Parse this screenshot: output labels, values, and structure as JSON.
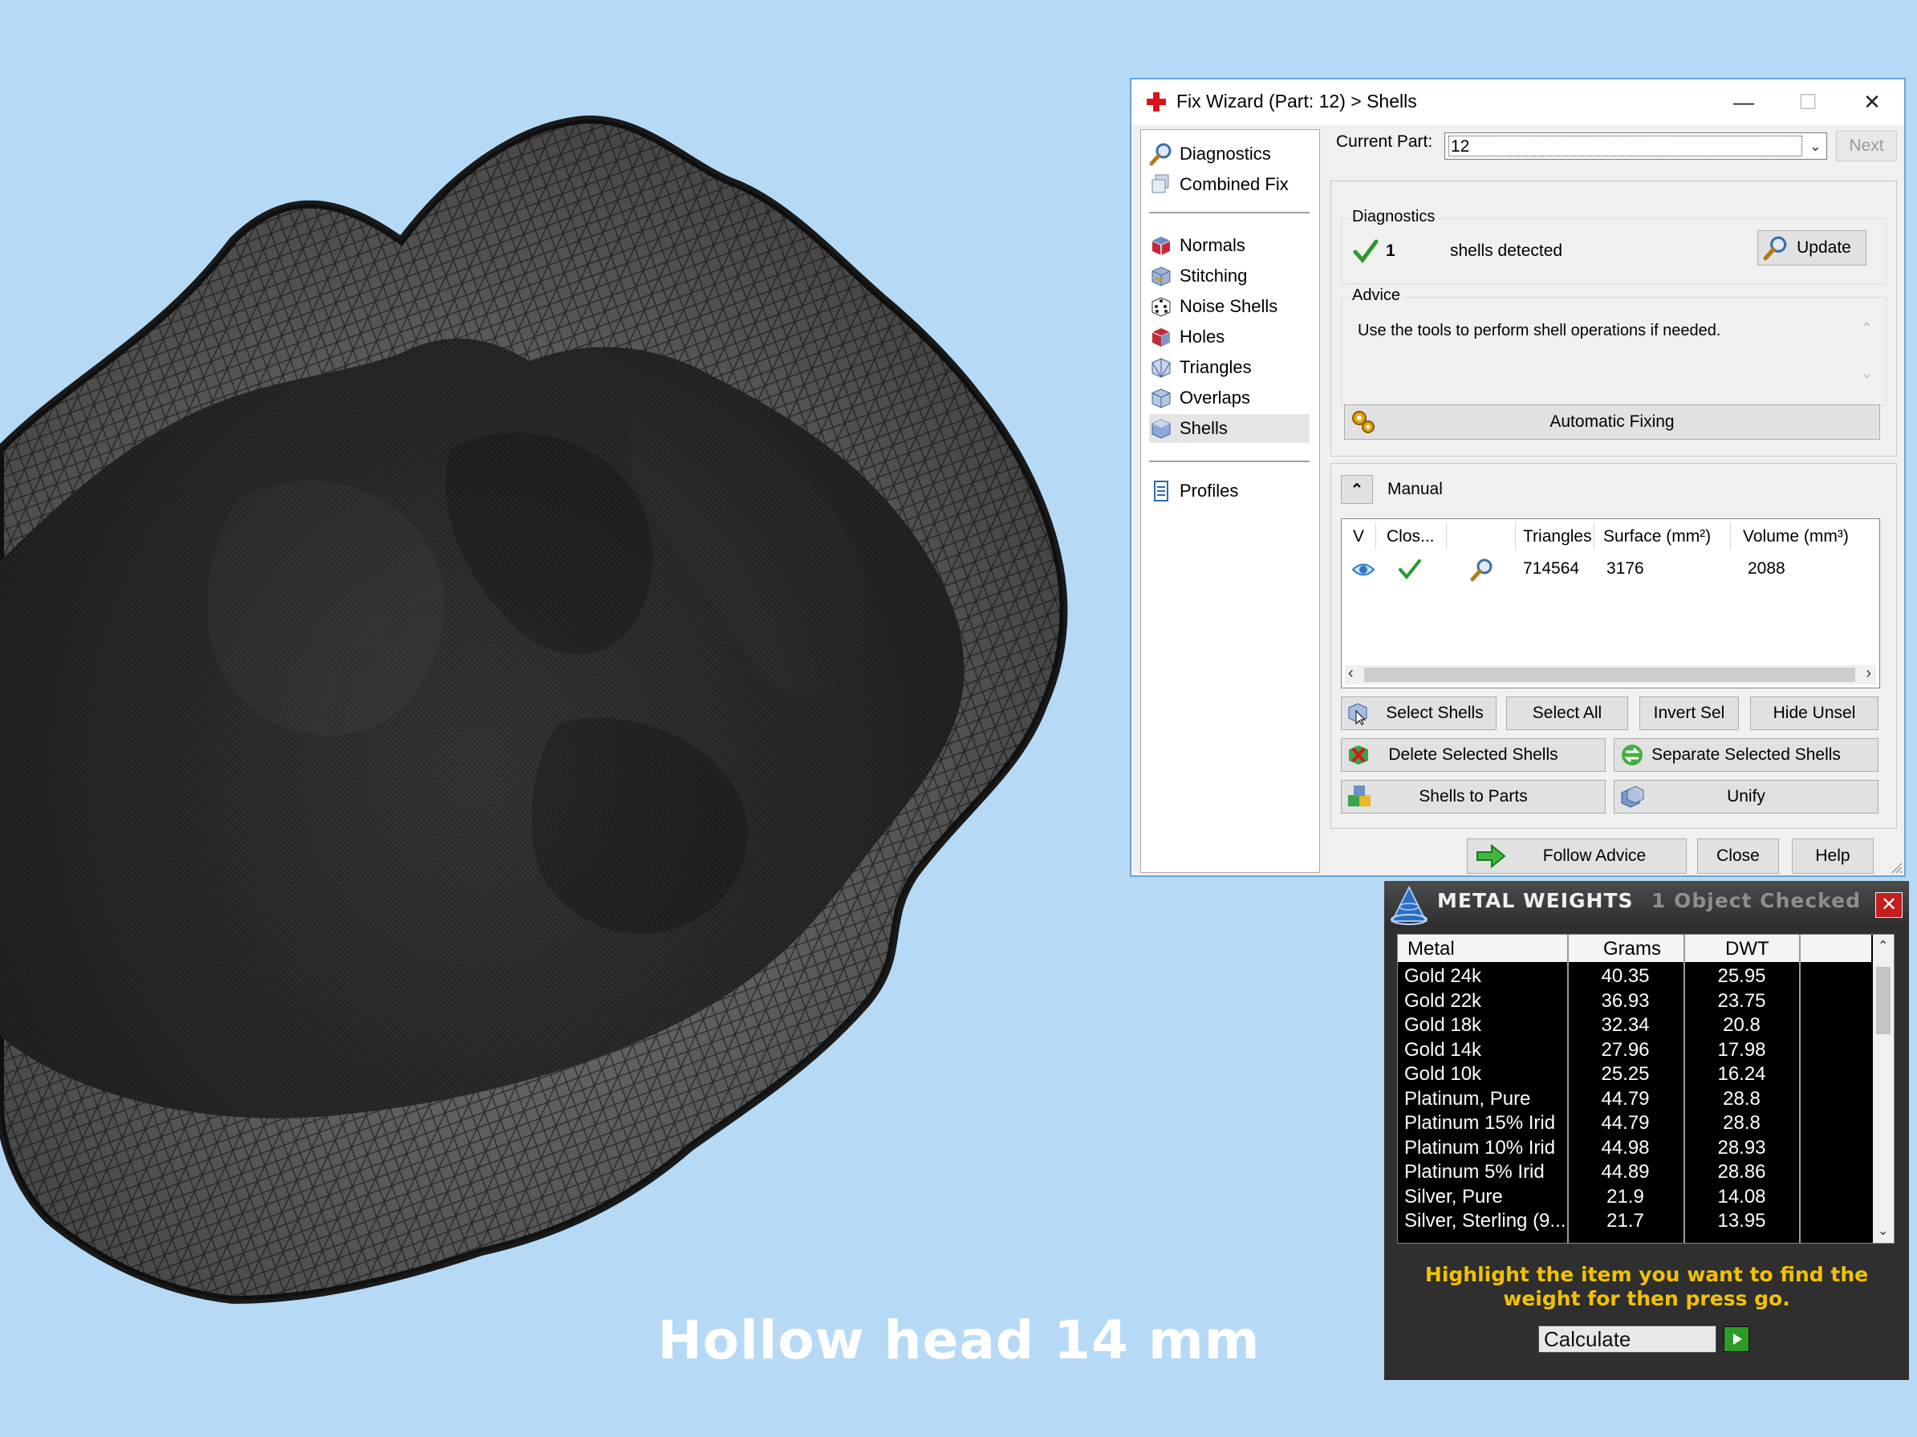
{
  "caption": "Hollow head 14 mm",
  "fix_wizard": {
    "title": "Fix Wizard (Part: 12) > Shells",
    "window_controls": {
      "minimize": "—",
      "maximize": "☐",
      "close": "✕"
    },
    "nav": {
      "top": [
        "Diagnostics",
        "Combined Fix"
      ],
      "tools": [
        "Normals",
        "Stitching",
        "Noise Shells",
        "Holes",
        "Triangles",
        "Overlaps",
        "Shells"
      ],
      "selected": "Shells",
      "bottom": [
        "Profiles"
      ]
    },
    "current_part_label": "Current Part:",
    "current_part_value": "12",
    "next_label": "Next",
    "diagnostics": {
      "group_title": "Diagnostics",
      "count": "1",
      "text": "shells detected",
      "update_label": "Update"
    },
    "advice": {
      "group_title": "Advice",
      "text": "Use the tools to perform shell operations if needed."
    },
    "automatic_fixing_label": "Automatic Fixing",
    "manual_label": "Manual",
    "table": {
      "headers": [
        "V",
        "Clos...",
        "Triangles",
        "Surface (mm²)",
        "Volume (mm³)"
      ],
      "rows": [
        {
          "triangles": "714564",
          "surface": "3176",
          "volume": "2088"
        }
      ]
    },
    "buttons": {
      "select_shells": "Select Shells",
      "select_all": "Select All",
      "invert_sel": "Invert Sel",
      "hide_unsel": "Hide Unsel",
      "delete_selected": "Delete Selected Shells",
      "separate_selected": "Separate Selected Shells",
      "shells_to_parts": "Shells to Parts",
      "unify": "Unify",
      "follow_advice": "Follow Advice",
      "close": "Close",
      "help": "Help"
    }
  },
  "metal_weights": {
    "title": "METAL WEIGHTS",
    "subtitle": "1 Object Checked",
    "columns": [
      "Metal",
      "Grams",
      "DWT"
    ],
    "rows": [
      {
        "metal": "Gold 24k",
        "grams": "40.35",
        "dwt": "25.95"
      },
      {
        "metal": "Gold 22k",
        "grams": "36.93",
        "dwt": "23.75"
      },
      {
        "metal": "Gold 18k",
        "grams": "32.34",
        "dwt": "20.8"
      },
      {
        "metal": "Gold 14k",
        "grams": "27.96",
        "dwt": "17.98"
      },
      {
        "metal": "Gold 10k",
        "grams": "25.25",
        "dwt": "16.24"
      },
      {
        "metal": "Platinum, Pure",
        "grams": "44.79",
        "dwt": "28.8"
      },
      {
        "metal": "Platinum 15% Irid",
        "grams": "44.79",
        "dwt": "28.8"
      },
      {
        "metal": "Platinum 10% Irid",
        "grams": "44.98",
        "dwt": "28.93"
      },
      {
        "metal": "Platinum 5% Irid",
        "grams": "44.89",
        "dwt": "28.86"
      },
      {
        "metal": "Silver, Pure",
        "grams": "21.9",
        "dwt": "14.08"
      },
      {
        "metal": "Silver, Sterling (9...",
        "grams": "21.7",
        "dwt": "13.95"
      }
    ],
    "message": "Highlight the item you want to find the weight for then press go.",
    "calculate_value": "Calculate",
    "close": "✕"
  }
}
